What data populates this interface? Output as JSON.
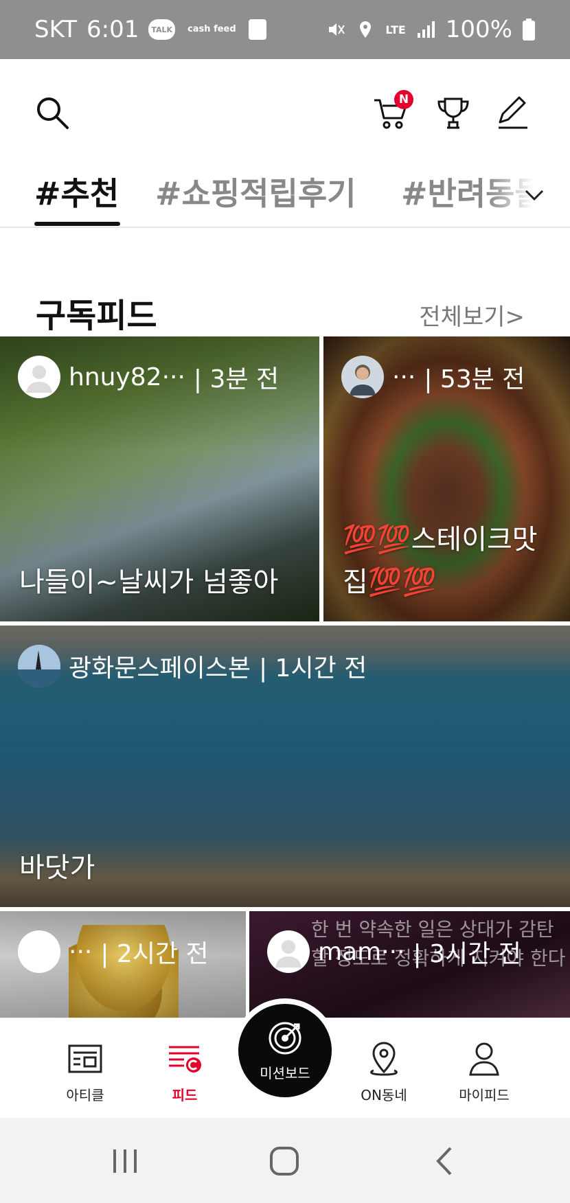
{
  "status_bar": {
    "carrier": "SKT",
    "time": "6:01",
    "talk": "TALK",
    "cash_feed": "cash feed",
    "network": "LTE",
    "battery": "100%"
  },
  "header": {
    "cart_badge": "N"
  },
  "tabs": [
    {
      "label": "#추천"
    },
    {
      "label": "#쇼핑적립후기"
    },
    {
      "label": "#반려동물"
    }
  ],
  "section": {
    "title": "구독피드",
    "see_all": "전체보기>"
  },
  "cards": [
    {
      "author": "hnuy82··· ",
      "time": "| 3분 전",
      "title": "나들이~날씨가 넘좋아"
    },
    {
      "author": "··· ",
      "time": "| 53분 전",
      "title": "💯💯스테이크맛집💯💯"
    },
    {
      "author": "광화문스페이스본",
      "time": "| 1시간 전",
      "title": "바닷가"
    },
    {
      "author": "···",
      "time": "| 2시간 전",
      "title": ""
    },
    {
      "author": "mam···",
      "time": "| 3시간 전",
      "title": "",
      "quote": "한 번 약속한 일은 상대가 감탄할 정도로 정확하게 지켜야 한다"
    }
  ],
  "bottom_nav": [
    {
      "label": "아티클"
    },
    {
      "label": "피드"
    },
    {
      "label": "미션보드"
    },
    {
      "label": "ON동네"
    },
    {
      "label": "마이피드"
    }
  ],
  "colors": {
    "accent": "#e3002b",
    "status_bar": "#8f8f8f"
  }
}
